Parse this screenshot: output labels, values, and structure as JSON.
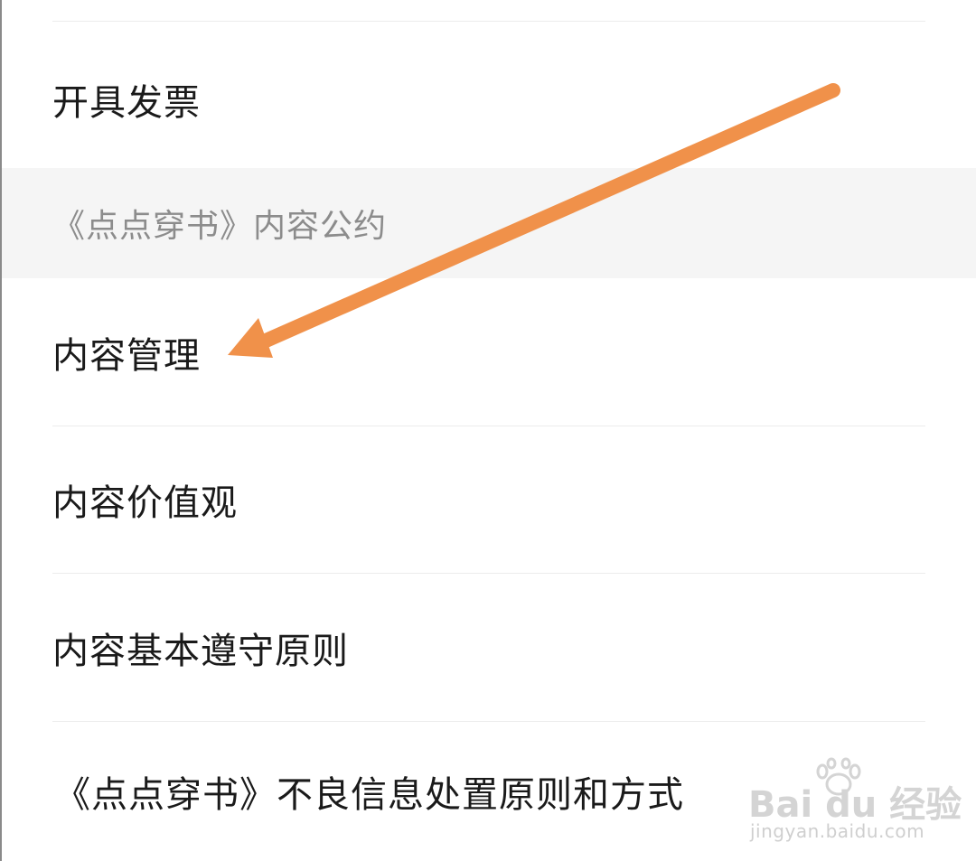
{
  "menu": {
    "invoice_label": "开具发票",
    "section_header": "《点点穿书》内容公约",
    "items": [
      {
        "label": "内容管理"
      },
      {
        "label": "内容价值观"
      },
      {
        "label": "内容基本遵守原则"
      },
      {
        "label": "《点点穿书》不良信息处置原则和方式"
      }
    ]
  },
  "annotation": {
    "arrow_color": "#f0914a"
  },
  "watermark": {
    "logo_text": "Bai du 经验",
    "url": "jingyan.baidu.com"
  }
}
